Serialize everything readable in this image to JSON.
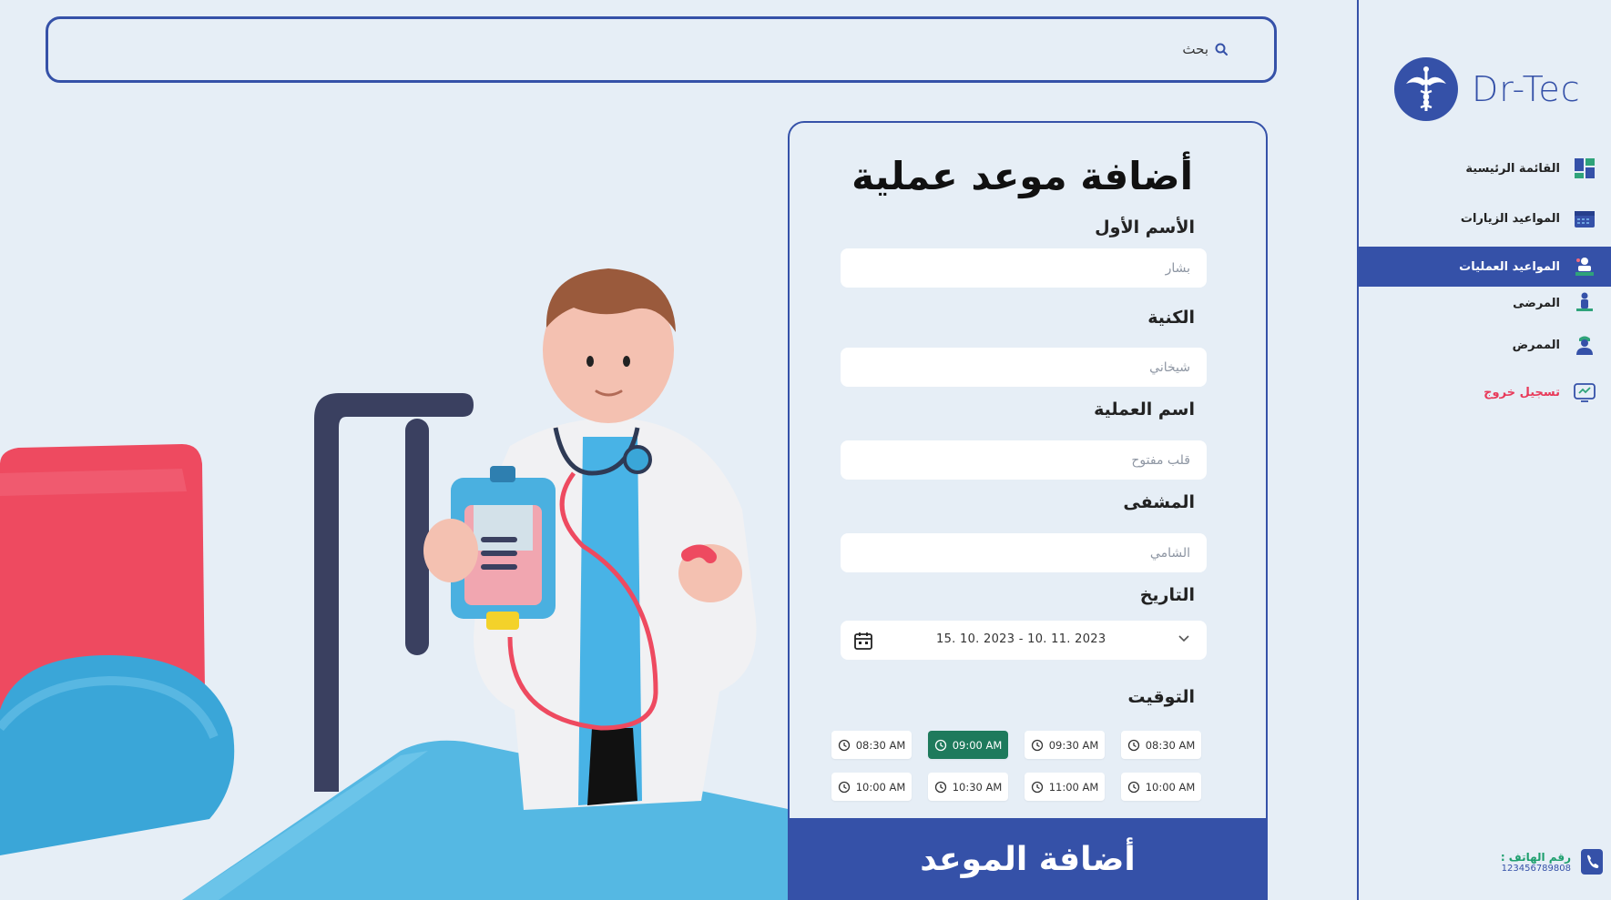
{
  "search": {
    "placeholder": "بحث"
  },
  "brand": {
    "name": "Dr-Tec"
  },
  "form": {
    "title": "أضافة موعد عملية",
    "first_name": {
      "label": "الأسم الأول",
      "placeholder": "بشار"
    },
    "last_name": {
      "label": "الكنية",
      "placeholder": "شيخاني"
    },
    "operation": {
      "label": "اسم العملية",
      "placeholder": "قلب مفتوح"
    },
    "hospital": {
      "label": "المشفى",
      "placeholder": "الشامي"
    },
    "date": {
      "label": "التاريخ",
      "range": "15. 10. 2023  -  10. 11. 2023"
    },
    "time": {
      "label": "التوقيت",
      "slots_row1": [
        "08:30 AM",
        "09:00 AM",
        "09:30 AM",
        "08:30 AM"
      ],
      "slots_row2": [
        "10:00 AM",
        "10:30 AM",
        "11:00 AM",
        "10:00 AM"
      ],
      "selected": "09:00 AM"
    },
    "submit_label": "أضافة الموعد"
  },
  "sidebar": {
    "items": [
      {
        "label": "القائمة الرئيسية",
        "icon": "dashboard-icon"
      },
      {
        "label": "المواعيد الزيارات",
        "icon": "calendar-icon"
      },
      {
        "label": "المواعيد العمليات",
        "icon": "surgery-icon",
        "active": true
      },
      {
        "label": "المرضى",
        "icon": "patient-icon"
      },
      {
        "label": "الممرض",
        "icon": "nurse-icon"
      },
      {
        "label": "تسجيل خروج",
        "icon": "logout-icon"
      }
    ],
    "phone": {
      "label": "رقم الهاتف :",
      "number": "123456789808"
    }
  },
  "colors": {
    "accent": "#3551a8",
    "selected_slot": "#1e7a5c",
    "logout": "#e83a5a",
    "phone_label": "#1e9f6e"
  }
}
